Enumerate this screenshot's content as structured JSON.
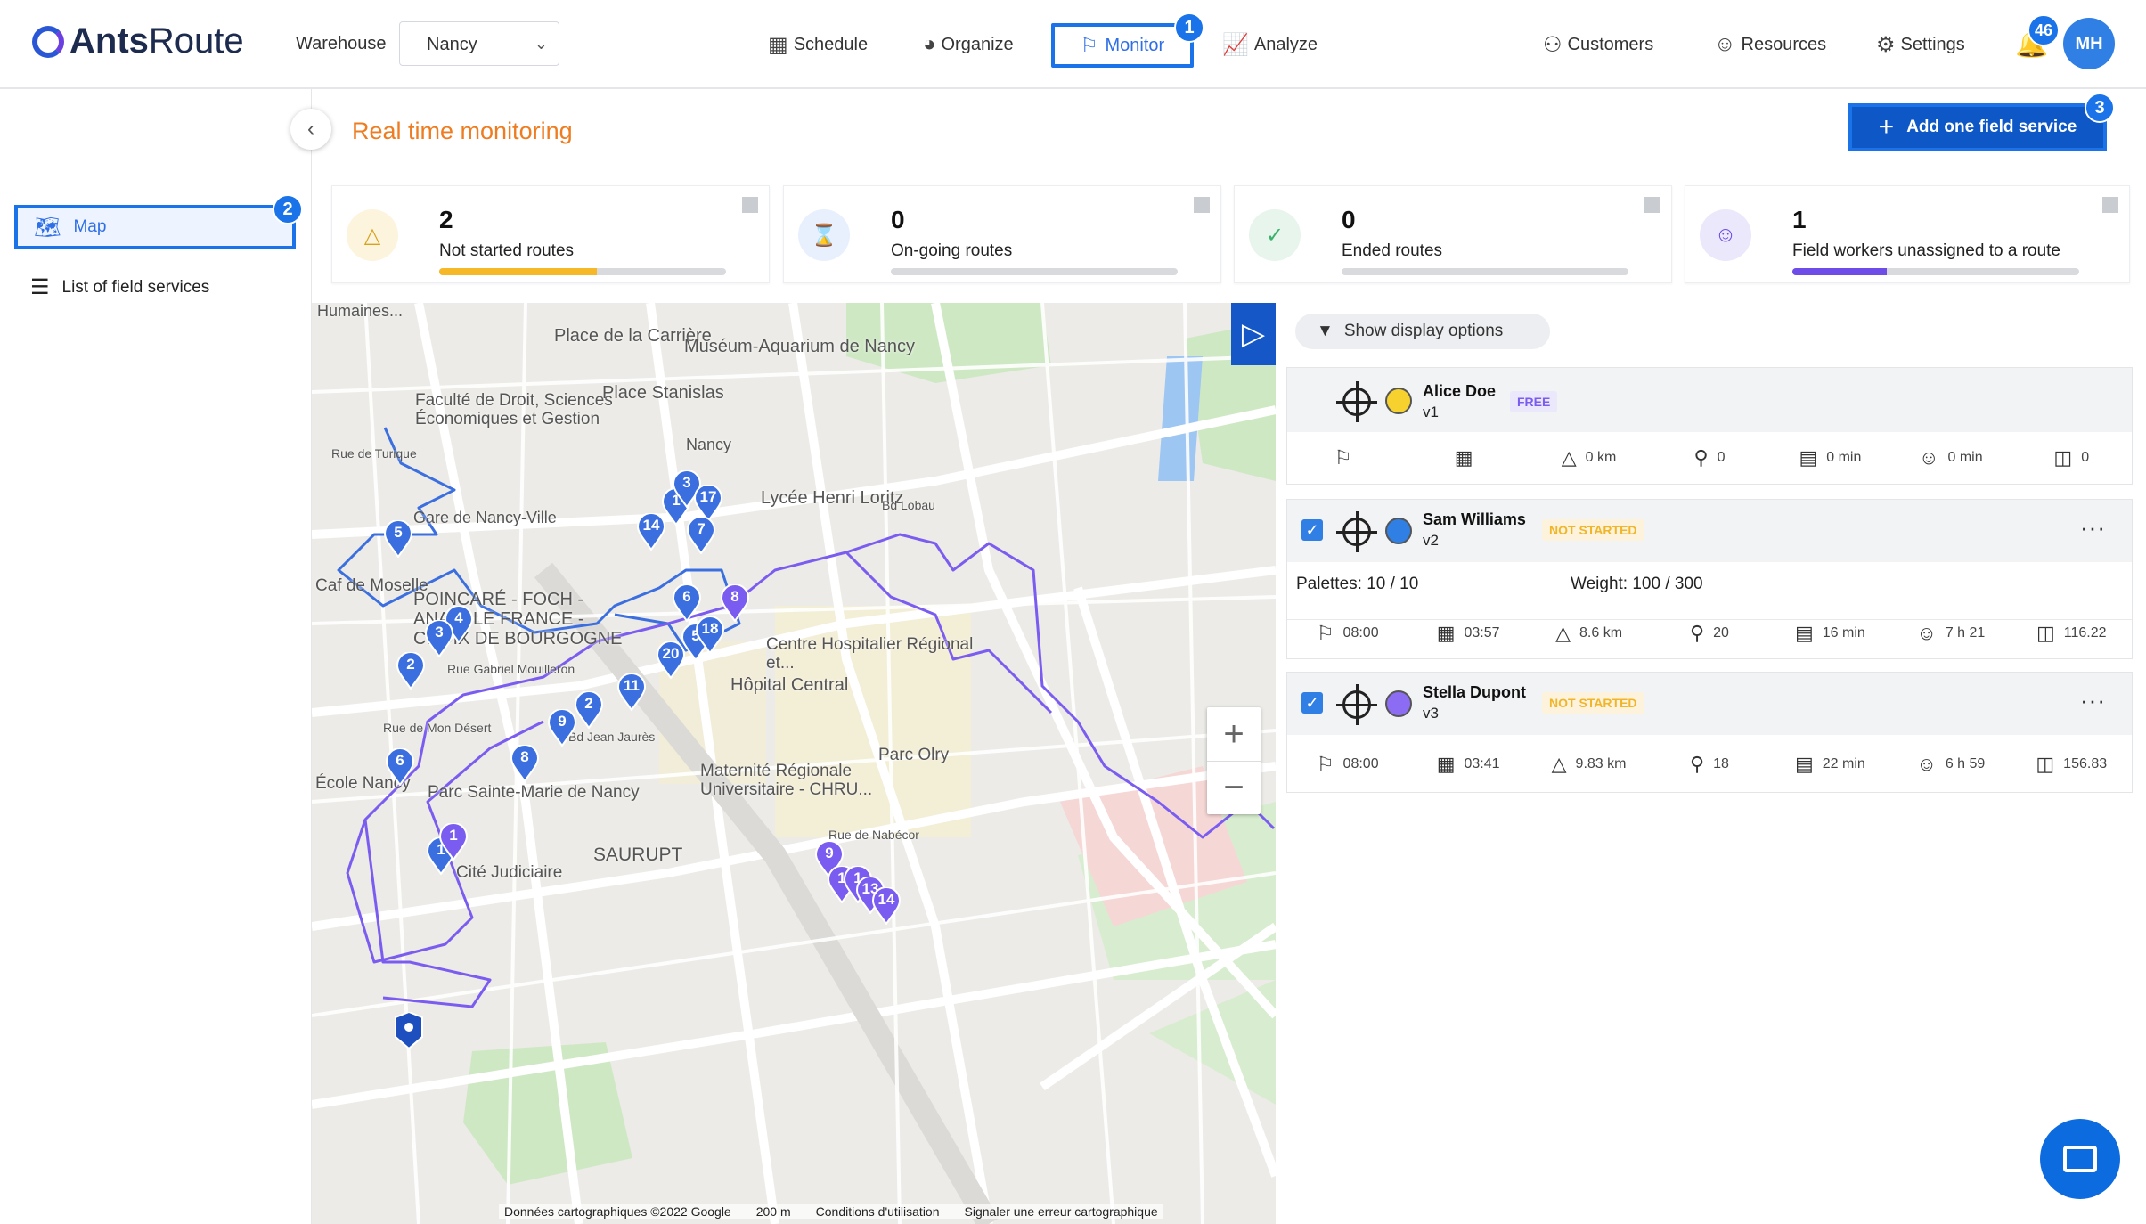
{
  "app": {
    "brand_a": "Ants",
    "brand_b": "Route"
  },
  "header": {
    "warehouse_label": "Warehouse",
    "warehouse_value": "Nancy",
    "nav": [
      {
        "label": "Schedule"
      },
      {
        "label": "Organize"
      },
      {
        "label": "Monitor"
      },
      {
        "label": "Analyze"
      }
    ],
    "right": [
      {
        "label": "Customers"
      },
      {
        "label": "Resources"
      },
      {
        "label": "Settings"
      }
    ],
    "notifications": "46",
    "avatar": "MH",
    "callout_1": "1"
  },
  "sidebar": {
    "items": [
      {
        "label": "Map"
      },
      {
        "label": "List of field services"
      }
    ],
    "callout_2": "2"
  },
  "page": {
    "title": "Real time monitoring",
    "add_button": "Add one field service",
    "callout_3": "3"
  },
  "kpis": [
    {
      "value": "2",
      "label": "Not started routes",
      "progress": 0.55,
      "color": "#f6b826",
      "bg": "#fdf4dd"
    },
    {
      "value": "0",
      "label": "On-going routes",
      "progress": 0,
      "color": "#3b82f6",
      "bg": "#e8f0fd"
    },
    {
      "value": "0",
      "label": "Ended routes",
      "progress": 0,
      "color": "#3bb26b",
      "bg": "#e7f5ec"
    },
    {
      "value": "1",
      "label": "Field workers unassigned to a route",
      "progress": 0.33,
      "color": "#6d4ce8",
      "bg": "#ece8fb"
    }
  ],
  "map": {
    "labels": [
      "Humaines...",
      "Place de la Carrière",
      "Muséum-Aquarium de Nancy",
      "Faculté de Droit, Sciences Économiques et Gestion",
      "Place Stanislas",
      "Gare de Nancy-Ville",
      "Lycée Henri Loritz",
      "Caf de Moselle",
      "POINCARÉ - FOCH - ANATOLE FRANCE - CROIX DE BOURGOGNE",
      "Centre Hospitalier Régional et...",
      "Hôpital Central",
      "Parc Olry",
      "Maternité Régionale Universitaire - CHRU...",
      "École Nancy",
      "Parc Sainte-Marie de Nancy",
      "SAURUPT",
      "Cité Judiciaire",
      "Nancy",
      "Rue de Turique",
      "Rue Gabriel Mouilleron",
      "Rue de Mon Désert",
      "Rue de Nabécor",
      "Bd Lobau",
      "Bd Jean Jaurès"
    ],
    "attribution": [
      "Données cartographiques ©2022 Google",
      "200 m",
      "Conditions d'utilisation",
      "Signaler une erreur cartographique"
    ],
    "route1_color": "#3b6fe0",
    "route2_color": "#7b5cf0",
    "markers_blue": [
      "5",
      "4",
      "3",
      "2",
      "6",
      "1",
      "8",
      "9",
      "2",
      "11",
      "14",
      "1",
      "6",
      "20",
      "5",
      "18",
      "3",
      "17",
      "7"
    ],
    "markers_purple": [
      "1",
      "9",
      "1",
      "1",
      "13",
      "14",
      "8"
    ]
  },
  "panel": {
    "show_options": "Show display options",
    "routes": [
      {
        "name": "Alice Doe",
        "vehicle": "v1",
        "tag": "FREE",
        "color": "#f7d22f",
        "stats": [
          "",
          "",
          "0 km",
          "0",
          "0 min",
          "0 min",
          "0"
        ]
      },
      {
        "name": "Sam Williams",
        "vehicle": "v2",
        "tag": "NOT STARTED",
        "color": "#2f7fe4",
        "palettes": "Palettes: 10 / 10",
        "weight": "Weight: 100 / 300",
        "stats": [
          "08:00",
          "03:57",
          "8.6 km",
          "20",
          "16 min",
          "7 h 21",
          "116.22"
        ]
      },
      {
        "name": "Stella Dupont",
        "vehicle": "v3",
        "tag": "NOT STARTED",
        "color": "#8b6cf2",
        "stats": [
          "08:00",
          "03:41",
          "9.83 km",
          "18",
          "22 min",
          "6 h 59",
          "156.83"
        ]
      }
    ]
  }
}
